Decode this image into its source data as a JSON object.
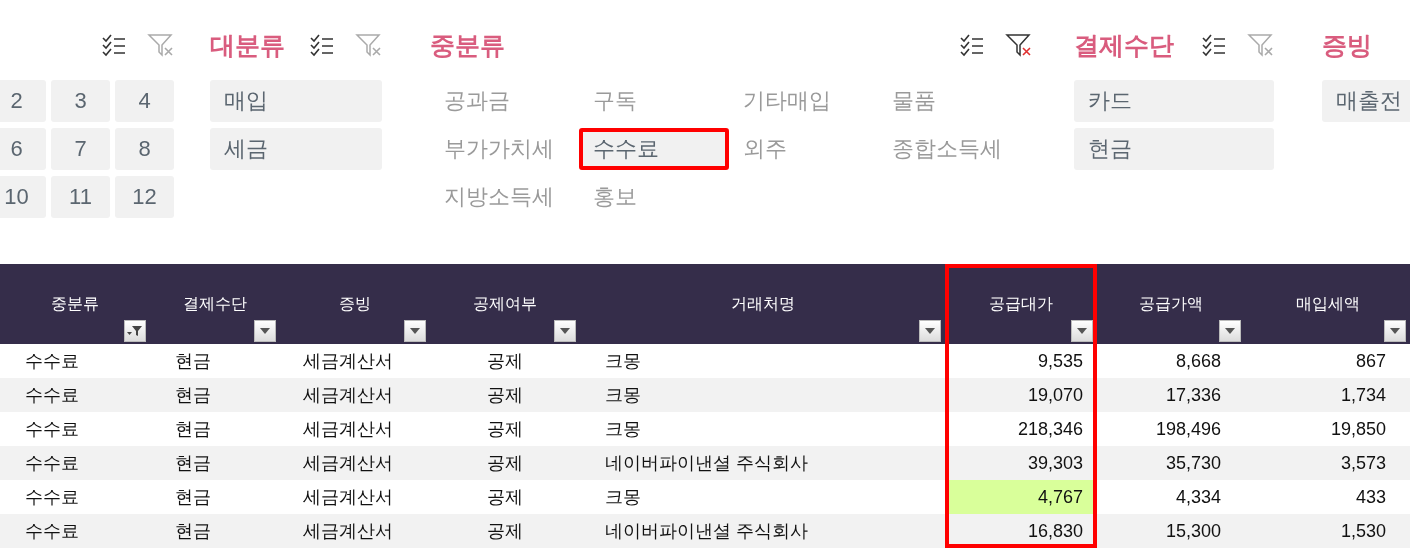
{
  "month_slicer": {
    "filtered": false,
    "items": [
      {
        "label": "2",
        "selected": true
      },
      {
        "label": "3",
        "selected": true
      },
      {
        "label": "4",
        "selected": true
      },
      {
        "label": "6",
        "selected": true
      },
      {
        "label": "7",
        "selected": true
      },
      {
        "label": "8",
        "selected": true
      },
      {
        "label": "10",
        "selected": true
      },
      {
        "label": "11",
        "selected": true
      },
      {
        "label": "12",
        "selected": true
      }
    ]
  },
  "slicers": [
    {
      "title": "대분류",
      "filtered": false,
      "items": [
        {
          "label": "매입",
          "selected": true,
          "annotated": false
        },
        {
          "label": "세금",
          "selected": true,
          "annotated": false
        }
      ]
    },
    {
      "title": "중분류",
      "filtered": true,
      "items": [
        {
          "label": "공과금",
          "selected": false,
          "annotated": false
        },
        {
          "label": "구독",
          "selected": false,
          "annotated": false
        },
        {
          "label": "기타매입",
          "selected": false,
          "annotated": false
        },
        {
          "label": "물품",
          "selected": false,
          "annotated": false
        },
        {
          "label": "부가가치세",
          "selected": false,
          "annotated": false
        },
        {
          "label": "수수료",
          "selected": true,
          "annotated": true
        },
        {
          "label": "외주",
          "selected": false,
          "annotated": false
        },
        {
          "label": "종합소득세",
          "selected": false,
          "annotated": false
        },
        {
          "label": "지방소득세",
          "selected": false,
          "annotated": false
        },
        {
          "label": "홍보",
          "selected": false,
          "annotated": false
        }
      ]
    },
    {
      "title": "결제수단",
      "filtered": false,
      "items": [
        {
          "label": "카드",
          "selected": true,
          "annotated": false
        },
        {
          "label": "현금",
          "selected": true,
          "annotated": false
        }
      ]
    },
    {
      "title": "증빙",
      "items": [
        {
          "label": "매출전",
          "selected": true,
          "annotated": false
        }
      ]
    }
  ],
  "table": {
    "columns": [
      {
        "label": "중분류",
        "filtered": true,
        "annotated": false
      },
      {
        "label": "결제수단",
        "filtered": false,
        "annotated": false
      },
      {
        "label": "증빙",
        "filtered": false,
        "annotated": false
      },
      {
        "label": "공제여부",
        "filtered": false,
        "annotated": false
      },
      {
        "label": "거래처명",
        "filtered": false,
        "annotated": false
      },
      {
        "label": "공급대가",
        "filtered": false,
        "annotated": true
      },
      {
        "label": "공급가액",
        "filtered": false,
        "annotated": false
      },
      {
        "label": "매입세액",
        "filtered": false,
        "annotated": false
      }
    ],
    "rows": [
      {
        "cells": [
          "수수료",
          "현금",
          "세금계산서",
          "공제",
          "크몽",
          "9,535",
          "8,668",
          "867"
        ]
      },
      {
        "cells": [
          "수수료",
          "현금",
          "세금계산서",
          "공제",
          "크몽",
          "19,070",
          "17,336",
          "1,734"
        ]
      },
      {
        "cells": [
          "수수료",
          "현금",
          "세금계산서",
          "공제",
          "크몽",
          "218,346",
          "198,496",
          "19,850"
        ]
      },
      {
        "cells": [
          "수수료",
          "현금",
          "세금계산서",
          "공제",
          "네이버파이낸셜 주식회사",
          "39,303",
          "35,730",
          "3,573"
        ]
      },
      {
        "cells": [
          "수수료",
          "현금",
          "세금계산서",
          "공제",
          "크몽",
          {
            "text": "4,767",
            "highlighted": true
          },
          "4,334",
          "433"
        ]
      },
      {
        "cells": [
          "수수료",
          "현금",
          "세금계산서",
          "공제",
          "네이버파이낸셜 주식회사",
          "16,830",
          "15,300",
          "1,530"
        ]
      }
    ]
  }
}
